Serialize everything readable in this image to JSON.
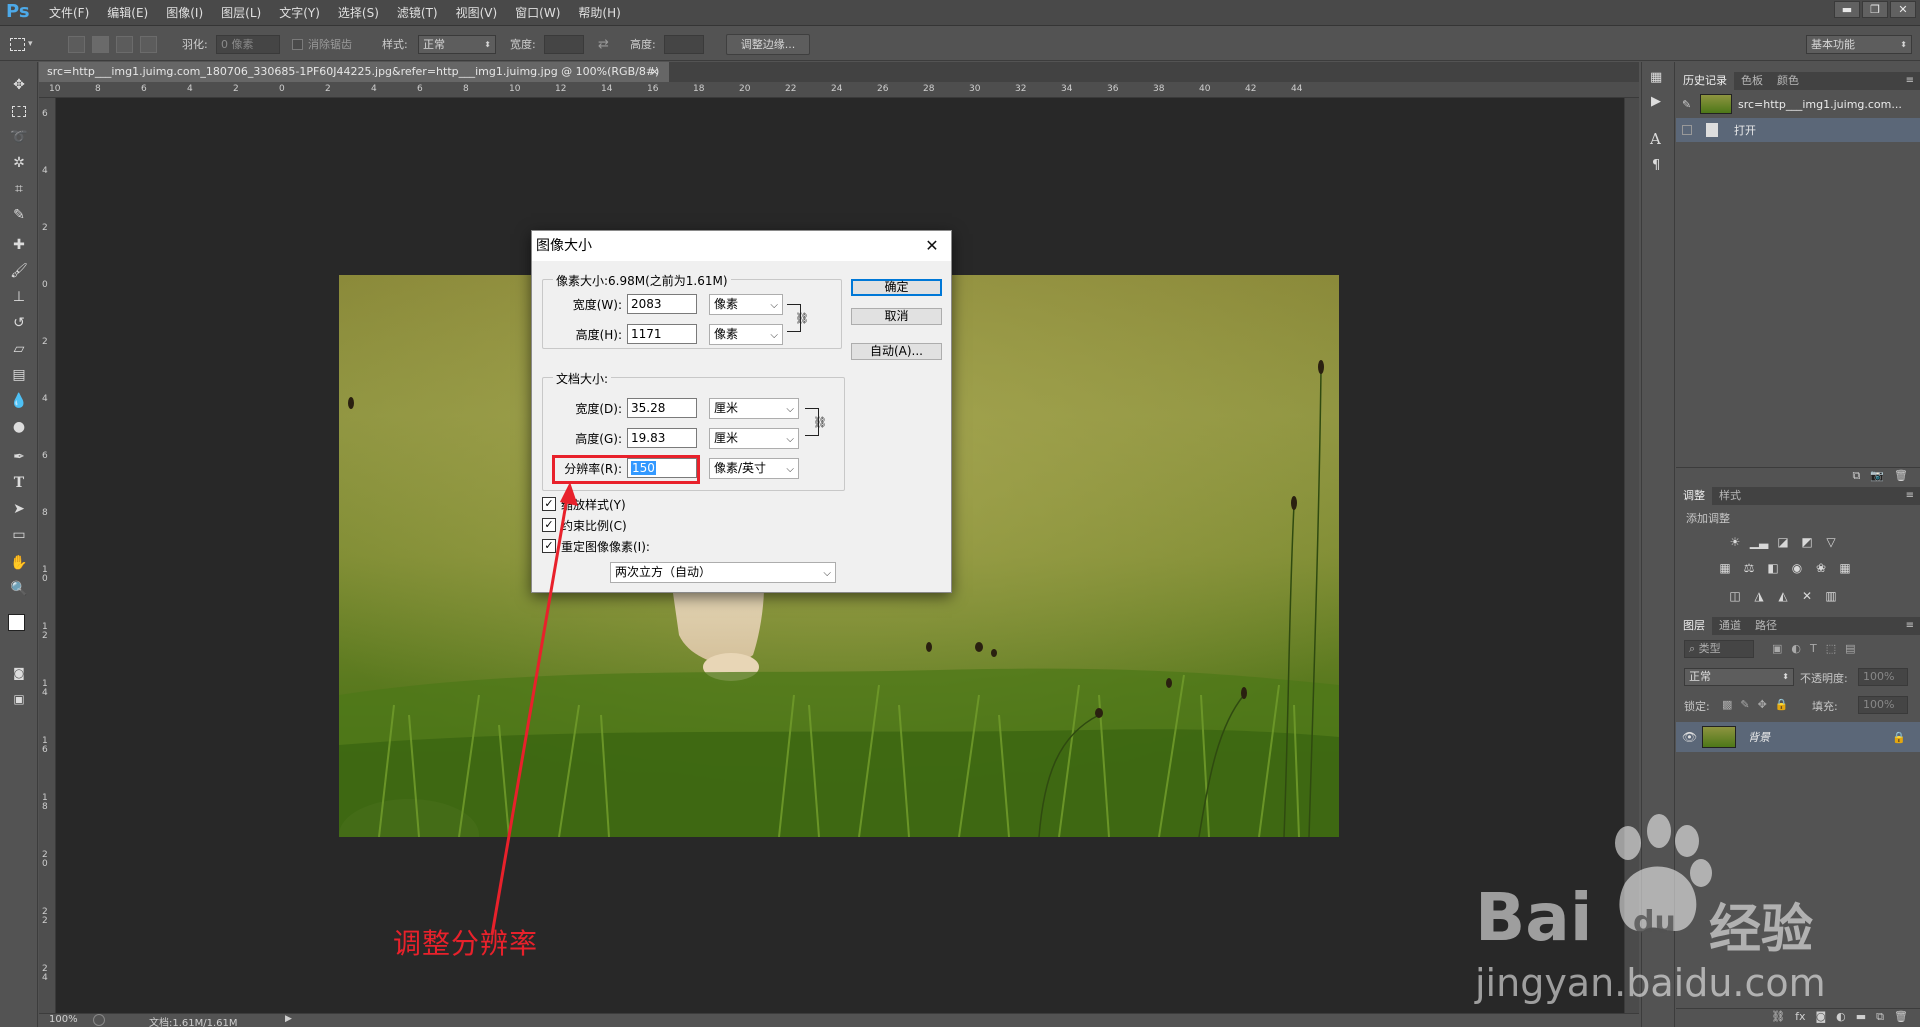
{
  "app": {
    "logo": "Ps"
  },
  "menu": [
    "文件(F)",
    "编辑(E)",
    "图像(I)",
    "图层(L)",
    "文字(Y)",
    "选择(S)",
    "滤镜(T)",
    "视图(V)",
    "窗口(W)",
    "帮助(H)"
  ],
  "options_bar": {
    "feather_label": "羽化:",
    "feather_value": "0 像素",
    "antialias_label": "消除锯齿",
    "style_label": "样式:",
    "style_value": "正常",
    "width_label": "宽度:",
    "height_label": "高度:",
    "refine_edge": "调整边缘...",
    "workspace": "基本功能"
  },
  "document": {
    "tab_title": "src=http___img1.juimg.com_180706_330685-1PF60J44225.jpg&refer=http___img1.juimg.jpg @ 100%(RGB/8#)",
    "close": "×",
    "zoom": "100%",
    "doc_info": "文档:1.61M/1.61M"
  },
  "ruler_h": [
    "10",
    "8",
    "6",
    "4",
    "2",
    "0",
    "2",
    "4",
    "6",
    "8",
    "10",
    "12",
    "14",
    "16",
    "18",
    "20",
    "22",
    "24",
    "26",
    "28",
    "30",
    "32",
    "34",
    "36",
    "38",
    "40",
    "42",
    "44"
  ],
  "ruler_v": [
    "6",
    "4",
    "2",
    "0",
    "2",
    "4",
    "6",
    "8",
    "10",
    "12",
    "14",
    "16",
    "18",
    "20",
    "22",
    "24"
  ],
  "dialog": {
    "title": "图像大小",
    "pixel_size_label": "像素大小:6.98M(之前为1.61M)",
    "width_label": "宽度(W):",
    "width_value": "2083",
    "width_unit": "像素",
    "height_label": "高度(H):",
    "height_value": "1171",
    "height_unit": "像素",
    "doc_size_label": "文档大小:",
    "doc_width_label": "宽度(D):",
    "doc_width_value": "35.28",
    "doc_width_unit": "厘米",
    "doc_height_label": "高度(G):",
    "doc_height_value": "19.83",
    "doc_height_unit": "厘米",
    "resolution_label": "分辨率(R):",
    "resolution_value": "150",
    "resolution_unit": "像素/英寸",
    "scale_styles": "缩放样式(Y)",
    "constrain": "约束比例(C)",
    "resample": "重定图像像素(I):",
    "resample_method": "两次立方（自动）",
    "ok": "确定",
    "cancel": "取消",
    "auto": "自动(A)..."
  },
  "annotation": {
    "text": "调整分辨率",
    "color": "#e8212b"
  },
  "panels": {
    "history_tabs": [
      "历史记录",
      "色板",
      "颜色"
    ],
    "history_snapshot": "src=http___img1.juimg.com...",
    "history_step": "打开",
    "adjust_tabs": [
      "调整",
      "样式"
    ],
    "add_adjustment": "添加调整",
    "layers_tabs": [
      "图层",
      "通道",
      "路径"
    ],
    "filter_kind": "类型",
    "blend_mode": "正常",
    "opacity_label": "不透明度:",
    "opacity_value": "100%",
    "lock_label": "锁定:",
    "fill_label": "填充:",
    "fill_value": "100%",
    "layer_name": "背景"
  },
  "watermark": {
    "brand": "Bai",
    "brand2": "du",
    "product": "经验",
    "url": "jingyan.baidu.com"
  },
  "colors": {
    "accent": "#4da9e8",
    "annotation": "#e8212b",
    "selection": "#3399ff"
  }
}
